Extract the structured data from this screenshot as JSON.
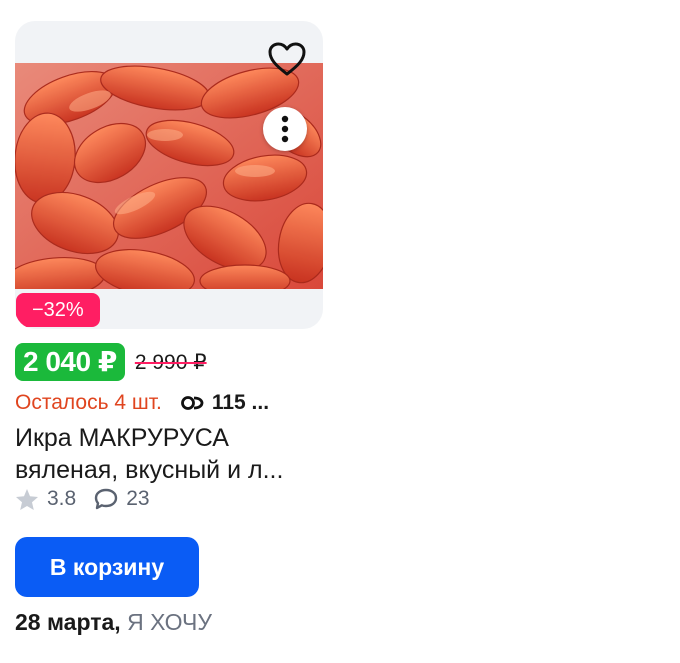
{
  "product": {
    "discount": "−32%",
    "price": "2 040 ₽",
    "old_price": "2 990 ₽",
    "stock": "Осталось 4 шт.",
    "views": "115 ...",
    "title_line1": "Икра МАКРУРУСА",
    "title_line2": "вяленая, вкусный и л...",
    "rating": "3.8",
    "reviews": "23",
    "cart_label": "В корзину",
    "delivery_date": "28 марта,",
    "seller": "Я ХОЧУ",
    "icons": {
      "favorite": "heart-outline-icon",
      "more": "more-vertical-icon",
      "views": "eye-icon",
      "rating": "star-icon",
      "reviews": "comment-icon"
    },
    "colors": {
      "price_badge": "#1bb93b",
      "discount_badge": "#ff1e63",
      "stock_text": "#e0451f",
      "cart_button": "#0a5cf5"
    }
  }
}
